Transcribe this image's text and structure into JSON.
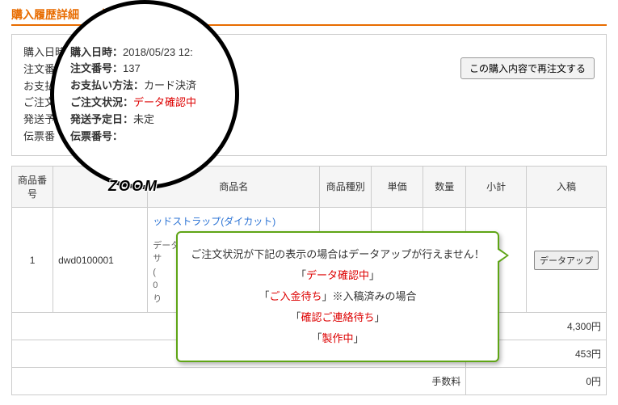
{
  "page": {
    "title_full": "購入履歴詳細",
    "title_suffix": "詳細"
  },
  "info": {
    "rows": [
      {
        "label": "購入日時",
        "value": ""
      },
      {
        "label": "注文番号",
        "value": ""
      },
      {
        "label": "お支払い",
        "value": ""
      },
      {
        "label": "ご注文",
        "value": ""
      },
      {
        "label": "発送予",
        "value": ""
      },
      {
        "label": "伝票番",
        "value": ""
      }
    ],
    "reorder_button": "この購入内容で再注文する"
  },
  "zoom": {
    "label_tag": "ZOOM",
    "rows": [
      {
        "label": "購入日時：",
        "value": "2018/05/23 12:",
        "red": false
      },
      {
        "label": "注文番号：",
        "value": "137",
        "red": false
      },
      {
        "label": "お支払い方法：",
        "value": "カード決済",
        "red": false
      },
      {
        "label": "ご注文状況：",
        "value": "データ確認中",
        "red": true
      },
      {
        "label": "発送予定日：",
        "value": "未定",
        "red": false
      },
      {
        "label": "伝票番号：",
        "value": "",
        "red": false
      }
    ]
  },
  "table": {
    "headers": {
      "no": "商品番号",
      "code": "",
      "name": "商品名",
      "type": "商品種別",
      "unit": "単価",
      "qty": "数量",
      "subtotal": "小計",
      "upload": "入稿"
    },
    "row": {
      "no": "1",
      "code": "dwd0100001",
      "name_link": "ッドストラップ(ダイカット)",
      "note": "データ制作お助けプラン:利用\nサ\n(\n0\nり",
      "upload_btn": "データアップ"
    },
    "totals": [
      {
        "label": "",
        "value": "4,300円"
      },
      {
        "label": "",
        "value": "453円"
      },
      {
        "label": "手数料",
        "value": "0円"
      }
    ]
  },
  "callout": {
    "lead": "ご注文状況が下記の表示の場合はデータアップが行えません！",
    "items": [
      "データ確認中",
      "ご入金待ち",
      "確認ご連絡待ち",
      "製作中"
    ],
    "note_suffix": "※入稿済みの場合"
  }
}
